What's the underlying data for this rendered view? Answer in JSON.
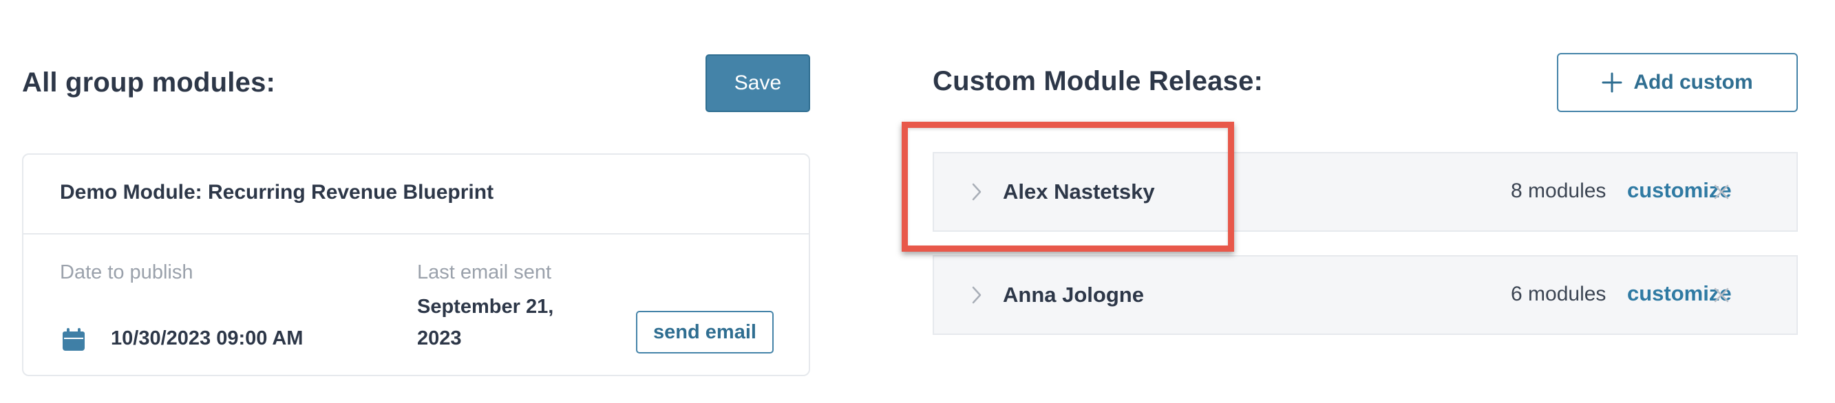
{
  "left_panel": {
    "heading": "All group modules:",
    "save_label": "Save",
    "module": {
      "title": "Demo Module: Recurring Revenue Blueprint",
      "date_label": "Date to publish",
      "date_value": "10/30/2023 09:00 AM",
      "last_email_label": "Last email sent",
      "last_email_value": "September 21, 2023",
      "send_email_label": "send email",
      "calendar_icon": "calendar-icon"
    }
  },
  "right_panel": {
    "heading": "Custom Module Release:",
    "add_custom_label": "Add custom",
    "add_icon": "plus-icon",
    "rows": [
      {
        "name": "Alex Nastetsky",
        "modules": "8 modules",
        "customize_label": "customize",
        "expand_icon": "chevron-right-icon",
        "remove_icon": "close-icon",
        "highlighted": true
      },
      {
        "name": "Anna Jologne",
        "modules": "6 modules",
        "customize_label": "customize",
        "expand_icon": "chevron-right-icon",
        "remove_icon": "close-icon",
        "highlighted": false
      }
    ]
  },
  "colors": {
    "accent": "#4483a8",
    "link": "#2f7aa3",
    "highlight": "#e8584a",
    "text": "#2d3748",
    "muted": "#9aa1ab",
    "row_bg": "#f5f6f8",
    "border": "#e6e9ed"
  }
}
